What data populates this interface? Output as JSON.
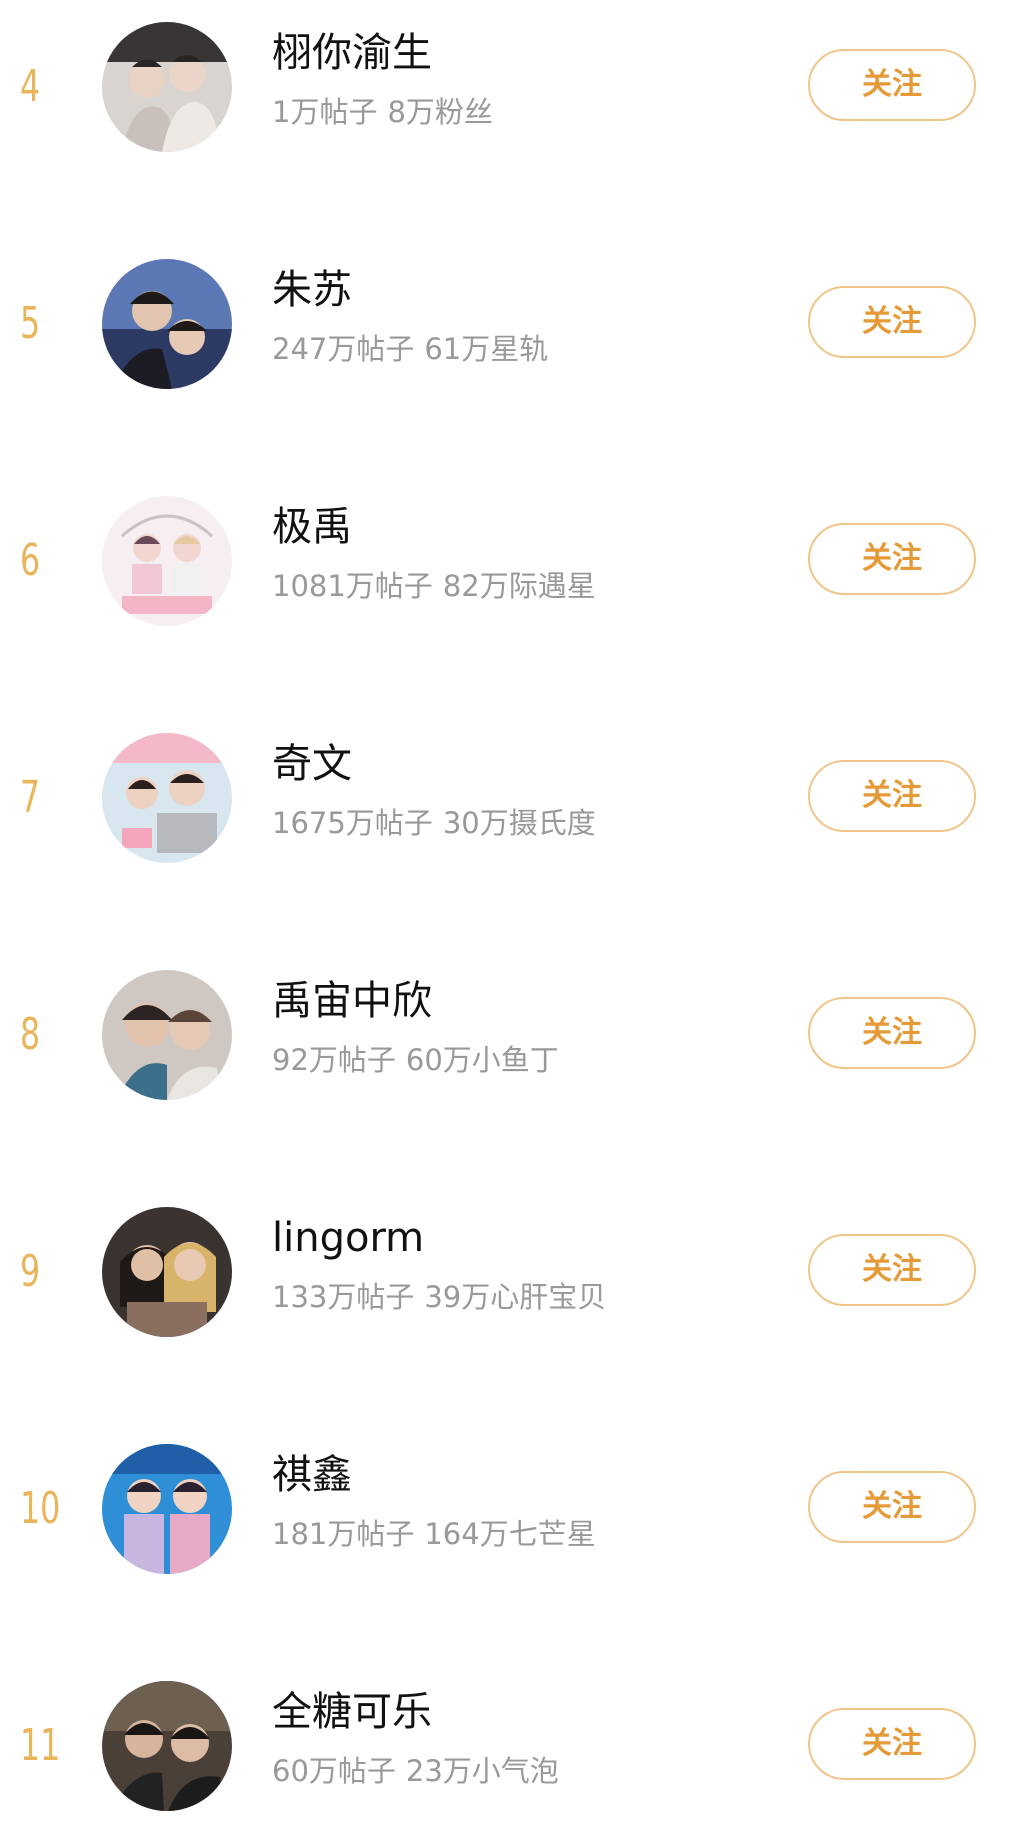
{
  "rows": [
    {
      "rank": "4",
      "name": "栩你渝生",
      "posts": "1万帖子",
      "fans": "8万粉丝",
      "follow_label": "关注"
    },
    {
      "rank": "5",
      "name": "朱苏",
      "posts": "247万帖子",
      "fans": "61万星轨",
      "follow_label": "关注"
    },
    {
      "rank": "6",
      "name": "极禹",
      "posts": "1081万帖子",
      "fans": "82万际遇星",
      "follow_label": "关注"
    },
    {
      "rank": "7",
      "name": "奇文",
      "posts": "1675万帖子",
      "fans": "30万摄氏度",
      "follow_label": "关注"
    },
    {
      "rank": "8",
      "name": "禹宙中欣",
      "posts": "92万帖子",
      "fans": "60万小鱼丁",
      "follow_label": "关注"
    },
    {
      "rank": "9",
      "name": "lingorm",
      "posts": "133万帖子",
      "fans": "39万心肝宝贝",
      "follow_label": "关注"
    },
    {
      "rank": "10",
      "name": "祺鑫",
      "posts": "181万帖子",
      "fans": "164万七芒星",
      "follow_label": "关注"
    },
    {
      "rank": "11",
      "name": "全糖可乐",
      "posts": "60万帖子",
      "fans": "23万小气泡",
      "follow_label": "关注"
    }
  ],
  "colors": {
    "rank": "#e9b45a",
    "follow_text": "#e59a37",
    "follow_border": "#f0c58a",
    "meta_text": "#999999",
    "name_text": "#111111"
  }
}
